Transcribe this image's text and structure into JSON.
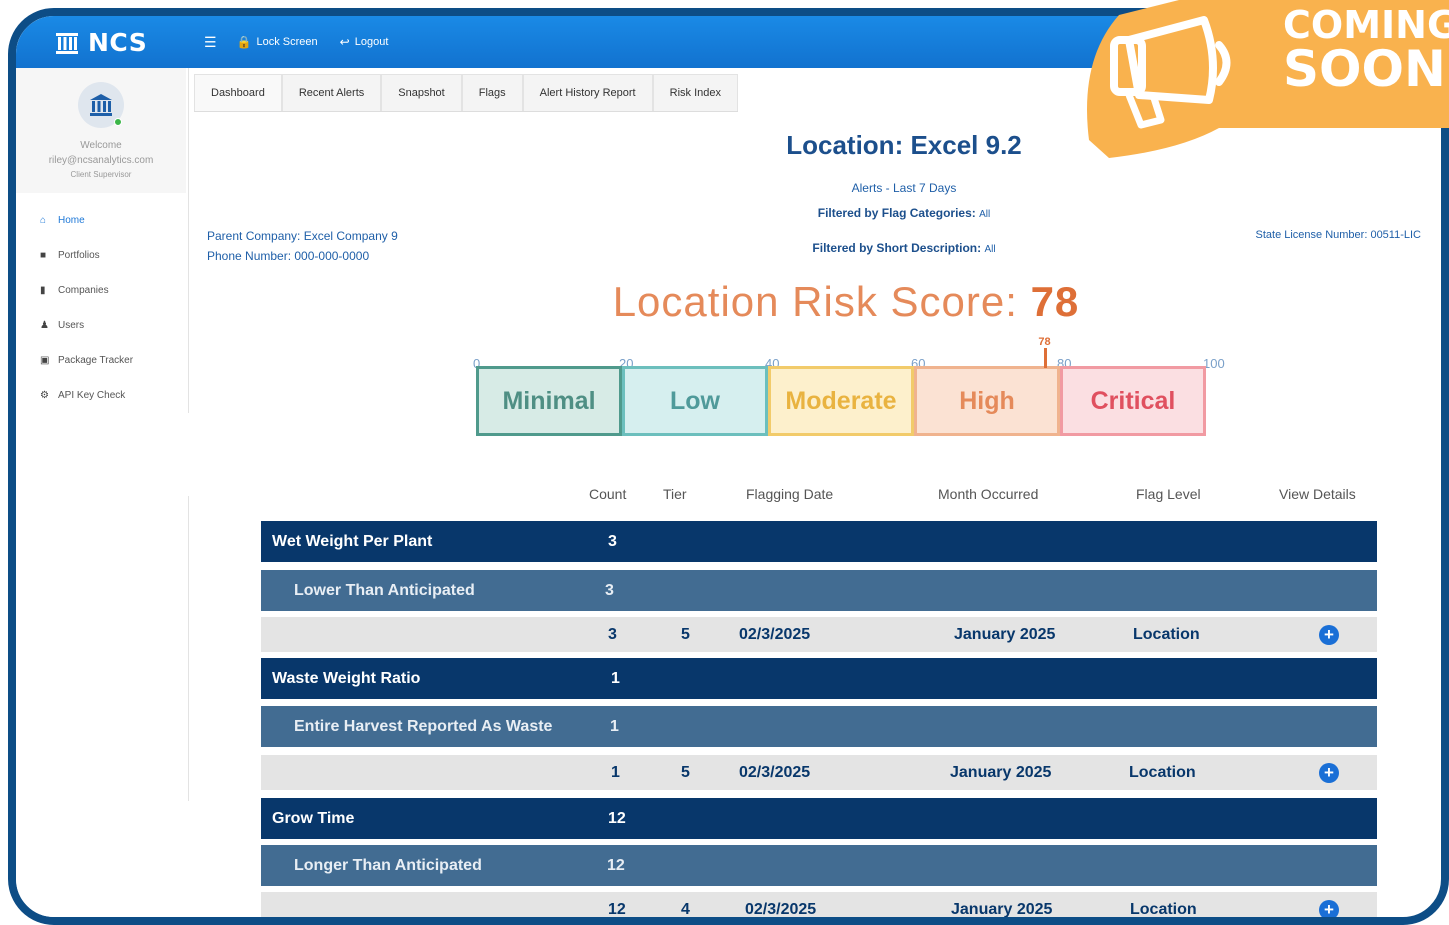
{
  "brand": {
    "name": "NCS"
  },
  "topbar": {
    "lock_label": "Lock Screen",
    "logout_label": "Logout"
  },
  "user": {
    "welcome": "Welcome",
    "email": "riley@ncsanalytics.com",
    "role": "Client Supervisor"
  },
  "sidebar": {
    "items": [
      {
        "label": "Home",
        "icon": "home-icon"
      },
      {
        "label": "Portfolios",
        "icon": "briefcase-icon"
      },
      {
        "label": "Companies",
        "icon": "building-icon"
      },
      {
        "label": "Users",
        "icon": "users-icon"
      },
      {
        "label": "Package Tracker",
        "icon": "package-icon"
      },
      {
        "label": "API Key Check",
        "icon": "gear-icon"
      }
    ]
  },
  "tabs": [
    {
      "label": "Dashboard"
    },
    {
      "label": "Recent Alerts"
    },
    {
      "label": "Snapshot"
    },
    {
      "label": "Flags"
    },
    {
      "label": "Alert History Report"
    },
    {
      "label": "Risk Index"
    }
  ],
  "location": {
    "title": "Location: Excel 9.2",
    "alerts_range": "Alerts - Last 7 Days",
    "flag_categories_label": "Filtered by Flag Categories:",
    "flag_categories_value": "All",
    "short_desc_label": "Filtered by Short Description:",
    "short_desc_value": "All",
    "parent_company": "Parent Company: Excel Company 9",
    "phone": "Phone Number: 000-000-0000",
    "license": "State License Number: 00511-LIC"
  },
  "risk": {
    "title_label": "Location Risk Score:",
    "score": "78",
    "score_value": 78,
    "ticks": [
      "0",
      "20",
      "40",
      "60",
      "80",
      "100"
    ],
    "bands": [
      {
        "label": "Minimal",
        "border": "#4f9a8c",
        "fill": "#d7ebe6",
        "text": "#4f8f84"
      },
      {
        "label": "Low",
        "border": "#6cbfbd",
        "fill": "#d6efef",
        "text": "#4f9a9a"
      },
      {
        "label": "Moderate",
        "border": "#f2cb6a",
        "fill": "#fdf0cc",
        "text": "#e9b340"
      },
      {
        "label": "High",
        "border": "#f0b38e",
        "fill": "#fbe2d3",
        "text": "#e58a5a"
      },
      {
        "label": "Critical",
        "border": "#f19aa2",
        "fill": "#fbdfe2",
        "text": "#e0505f"
      }
    ]
  },
  "table": {
    "headers": [
      "Count",
      "Tier",
      "Flagging Date",
      "Month Occurred",
      "Flag Level",
      "View Details"
    ],
    "groups": [
      {
        "name": "Wet Weight Per Plant",
        "count": "3",
        "sub": {
          "name": "Lower Than Anticipated",
          "count": "3"
        },
        "detail": {
          "count": "3",
          "tier": "5",
          "date": "02/3/2025",
          "month": "January 2025",
          "level": "Location"
        }
      },
      {
        "name": "Waste Weight Ratio",
        "count": "1",
        "sub": {
          "name": "Entire Harvest Reported As Waste",
          "count": "1"
        },
        "detail": {
          "count": "1",
          "tier": "5",
          "date": "02/3/2025",
          "month": "January 2025",
          "level": "Location"
        }
      },
      {
        "name": "Grow Time",
        "count": "12",
        "sub": {
          "name": "Longer Than Anticipated",
          "count": "12"
        },
        "detail": {
          "count": "12",
          "tier": "4",
          "date": "02/3/2025",
          "month": "January 2025",
          "level": "Location"
        }
      }
    ]
  },
  "badge": {
    "line1": "COMING",
    "line2": "SOON",
    "color": "#f9b24e"
  }
}
